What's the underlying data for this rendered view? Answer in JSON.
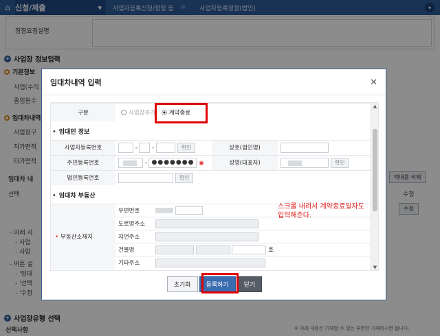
{
  "topbar": {
    "home_icon": "home-icon",
    "section_title": "신청/제출",
    "crumbs": [
      "사업자등록신청/정정 등",
      "사업자등록정정(법인)"
    ]
  },
  "background": {
    "row1_label": "정정요청설명",
    "section_business": "사업장 정보입력",
    "basic_info": "기본정보",
    "lbl_business": "사업(수익",
    "lbl_staff": "종업원수",
    "lease_info": "임대차내역",
    "lbl_own": "사업장구",
    "lbl_self": "자가면적",
    "lbl_other": "타가면적",
    "lease_header": "임대차 내",
    "select_col": "선택",
    "delete_btn": "택내용 삭제",
    "edit_col": "수정",
    "edit_btn": "수정",
    "notes": [
      "- 아래 사",
      "- 사업",
      "- 사업",
      "- 버튼 설",
      "- '임대",
      "- '선택",
      "- '수정"
    ],
    "section_type": "사업장유형 선택",
    "select_item": "선택사항",
    "footnote": "※ 아래 내용은 기재할 수 있는 부분만 기재하시면 됩니다."
  },
  "modal": {
    "title": "임대차내역 입력",
    "type_label": "구분",
    "radio_add": "사업장추가",
    "radio_end": "계약종료",
    "lessor_heading": "임대인 정보",
    "biz_reg_no": "사업자등록번호",
    "confirm_btn": "확인",
    "company_name": "상호(법인명)",
    "resident_no": "주민등록번호",
    "password_mask": "●●●●●●●",
    "representative": "성명(대표자)",
    "corp_reg_no": "법인등록번호",
    "property_heading": "임대차 부동산",
    "property_location": "부동산소재지",
    "zip_code": "우편번호",
    "road_address": "도로명주소",
    "lot_address": "지번주소",
    "building": "건물명",
    "ho_suffix": "호",
    "other_address": "기타주소",
    "btn_reset": "초기화",
    "btn_register": "등록하기",
    "btn_close": "닫기"
  },
  "annotation": {
    "line1": "스크롤 내려서 계약종료일자도",
    "line2": "입력해준다."
  }
}
